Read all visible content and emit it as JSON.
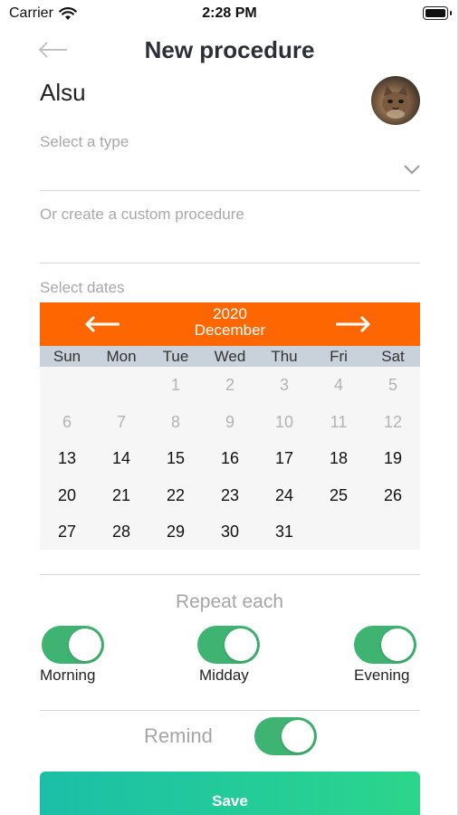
{
  "status_bar": {
    "carrier": "Carrier",
    "time": "2:28 PM"
  },
  "header": {
    "title": "New procedure",
    "back_icon": "arrow-left-icon"
  },
  "patient": {
    "name": "Alsu",
    "avatar": "cat-avatar"
  },
  "type_field": {
    "label": "Select a type"
  },
  "custom_field": {
    "label": "Or create a custom procedure"
  },
  "dates_label": "Select dates",
  "calendar": {
    "year": "2020",
    "month": "December",
    "weekdays": [
      "Sun",
      "Mon",
      "Tue",
      "Wed",
      "Thu",
      "Fri",
      "Sat"
    ],
    "first_weekday_index": 2,
    "days_in_month": 31,
    "first_enabled_day": 13,
    "colors": {
      "header": "#fd6600",
      "weekday_bar": "#c9d1db",
      "disabled_day": "#b3b3b3"
    }
  },
  "repeat": {
    "label": "Repeat each",
    "options": [
      {
        "label": "Morning",
        "on": true
      },
      {
        "label": "Midday",
        "on": true
      },
      {
        "label": "Evening",
        "on": true
      }
    ]
  },
  "remind": {
    "label": "Remind",
    "on": true
  },
  "save_button": {
    "label": "Save"
  },
  "colors": {
    "toggle_on": "#3fb371",
    "accent": "#fd6600",
    "save_gradient_start": "#1bbfa8",
    "save_gradient_end": "#2bd68b"
  }
}
